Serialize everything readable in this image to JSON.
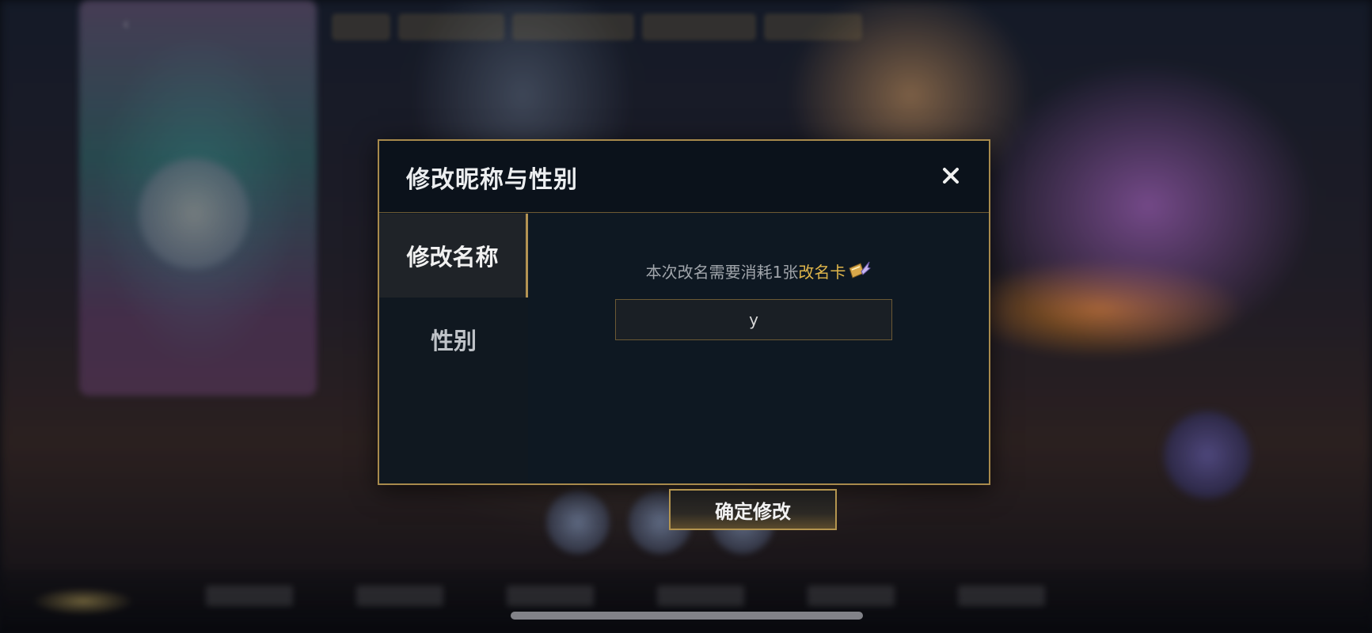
{
  "dialog": {
    "title": "修改昵称与性别",
    "close_icon": "close-icon"
  },
  "tabs": [
    {
      "label": "修改名称",
      "active": true
    },
    {
      "label": "性别",
      "active": false
    }
  ],
  "rename": {
    "notice_prefix": "本次改名需要消耗1张",
    "notice_highlight": "改名卡",
    "card_icon": "rename-card-icon",
    "input_value": "y",
    "confirm_label": "确定修改"
  },
  "colors": {
    "accent_gold": "#b39353",
    "highlight": "#e0b64b"
  }
}
